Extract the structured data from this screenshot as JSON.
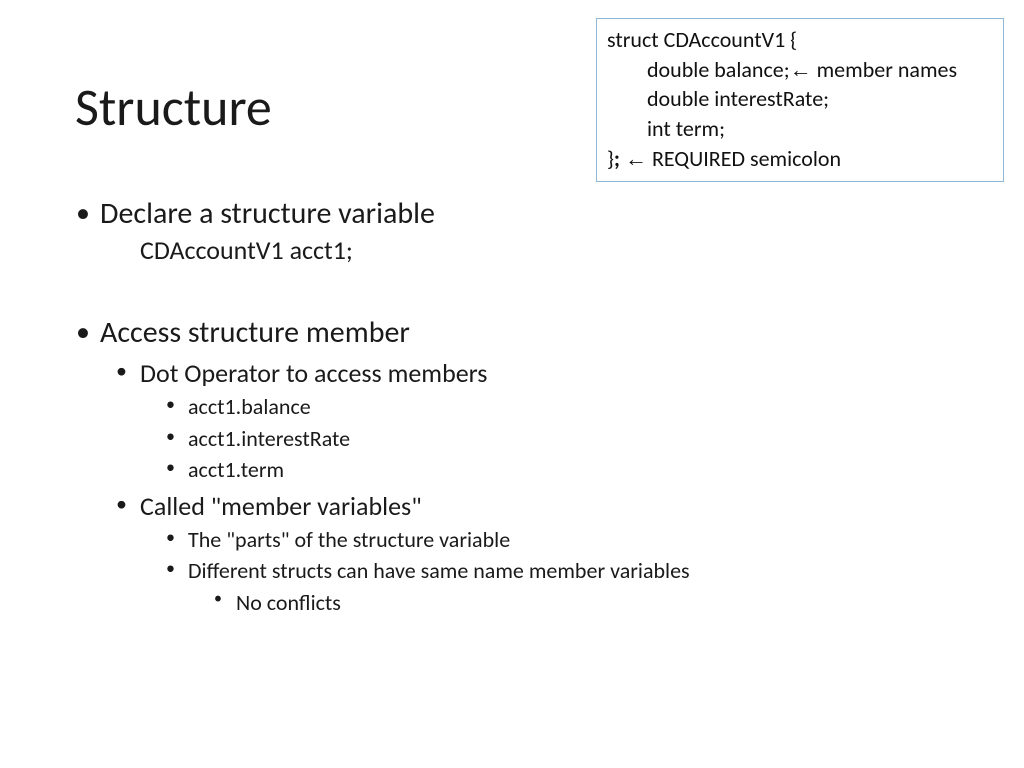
{
  "title": "Structure",
  "codebox": {
    "line1": "struct CDAccountV1   {",
    "line2_indent": "double balance;",
    "line2_annot": " member names",
    "line3_indent": "double interestRate;",
    "line4_indent": "int term;",
    "line5_close": "}",
    "line5_semicolon": ";",
    "line5_annot": " REQUIRED semicolon",
    "arrow_glyph": "←"
  },
  "bullets": {
    "b1": {
      "head": "Declare a structure variable",
      "sub": "CDAccountV1 acct1;"
    },
    "b2": {
      "head": "Access structure member",
      "c1": {
        "head": "Dot Operator to access members",
        "items": [
          "acct1.balance",
          "acct1.interestRate",
          "acct1.term"
        ]
      },
      "c2": {
        "head": "Called \"member variables\"",
        "d1": "The \"parts\" of the structure variable",
        "d2": "Different structs can have same name member variables",
        "d2a": "No conflicts"
      }
    }
  }
}
